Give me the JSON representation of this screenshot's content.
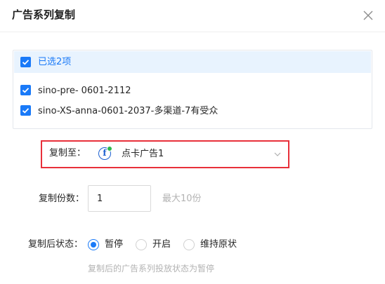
{
  "dialog": {
    "title": "广告系列复制",
    "close_icon": "close-icon"
  },
  "selection": {
    "header_label": "已选2项",
    "items": [
      {
        "label": "sino-pre- 0601-2112",
        "checked": true
      },
      {
        "label": "sino-XS-anna-0601-2037-多渠道-7有受众",
        "checked": true
      }
    ]
  },
  "destination": {
    "label": "复制至：",
    "icon": "facebook-icon",
    "value": "点卡广告1",
    "status_color": "#2bb84e"
  },
  "copies": {
    "label": "复制份数：",
    "value": "1",
    "hint": "最大10份"
  },
  "state": {
    "label": "复制后状态：",
    "options": [
      {
        "label": "暂停",
        "selected": true
      },
      {
        "label": "开启",
        "selected": false
      },
      {
        "label": "维持原状",
        "selected": false
      }
    ],
    "hint": "复制后的广告系列投放状态为暂停"
  },
  "colors": {
    "accent": "#1a7af8",
    "highlight_border": "#e8303a",
    "header_bg": "#e8f3fe"
  }
}
